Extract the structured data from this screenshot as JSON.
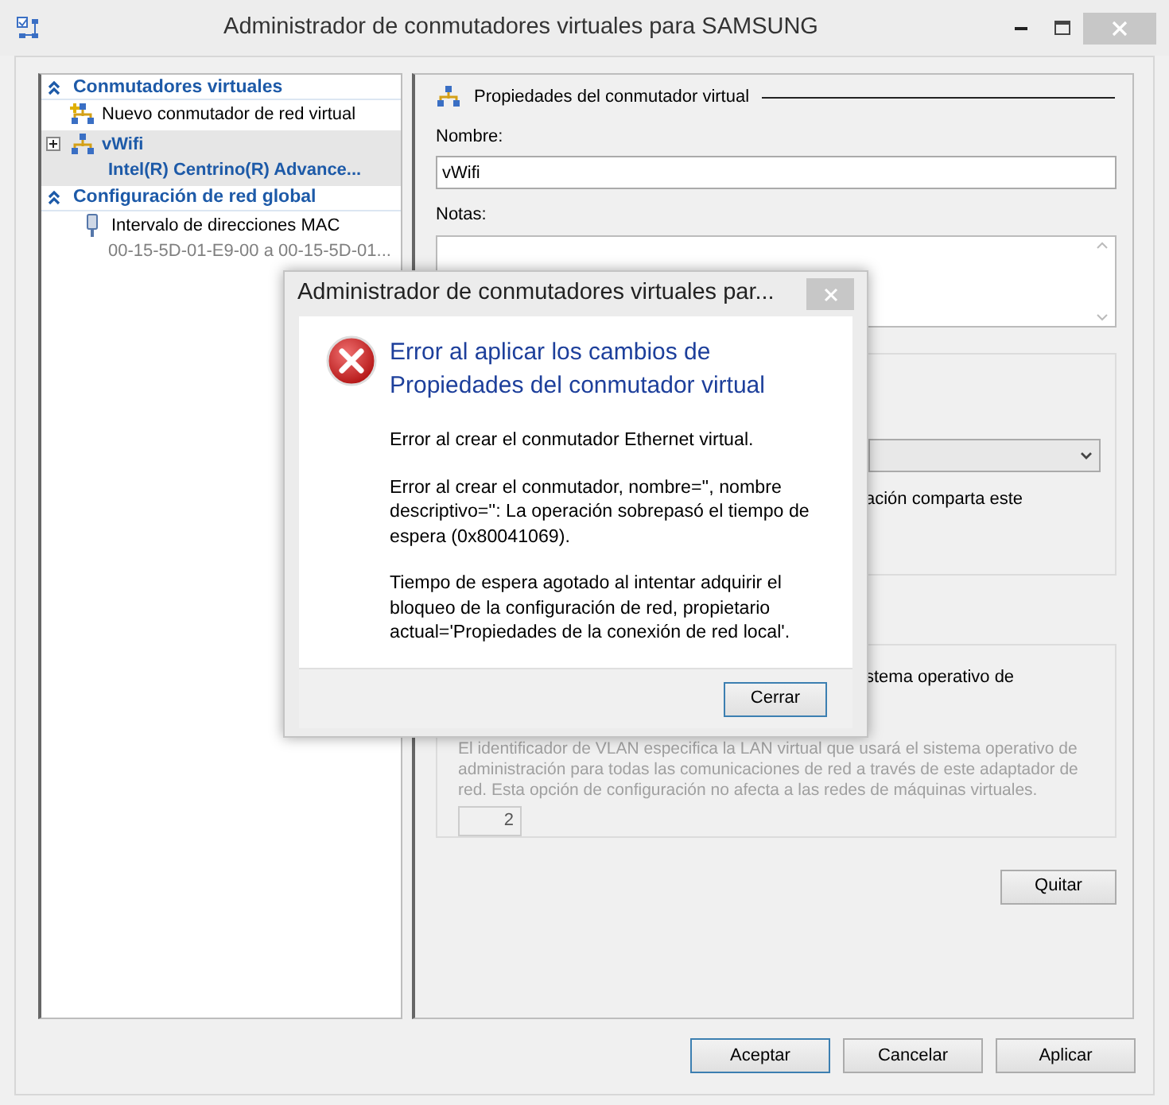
{
  "window": {
    "title": "Administrador de conmutadores virtuales para SAMSUNG"
  },
  "sidebar": {
    "sections": [
      {
        "title": "Conmutadores virtuales",
        "expanded": true,
        "items": [
          {
            "kind": "new",
            "label": "Nuevo conmutador de red virtual",
            "selected": false
          },
          {
            "kind": "switch",
            "label": "vWifi",
            "sublabel": "Intel(R) Centrino(R) Advance...",
            "selected": true,
            "expanded": false
          }
        ]
      },
      {
        "title": "Configuración de red global",
        "expanded": true,
        "items": [
          {
            "kind": "mac",
            "label": "Intervalo de direcciones MAC",
            "sublabel": "00-15-5D-01-E9-00 a 00-15-5D-01...",
            "selected": false
          }
        ]
      }
    ]
  },
  "properties": {
    "title": "Propiedades del conmutador virtual",
    "name_label": "Nombre:",
    "name_value": "vWifi",
    "notes_label": "Notas:",
    "connection_text": "ación comparta este",
    "vlan_text": "stema operativo de",
    "vlan_description": "El identificador de VLAN especifica la LAN virtual que usará el sistema operativo de administración para todas las comunicaciones de red a través de este adaptador de red. Esta opción de configuración no afecta a las redes de máquinas virtuales.",
    "vlan_id": "2",
    "vlan_disabled": true,
    "remove_button": "Quitar"
  },
  "buttons": [
    {
      "label": "Aceptar",
      "default": true
    },
    {
      "label": "Cancelar",
      "default": false
    },
    {
      "label": "Aplicar",
      "default": false
    }
  ],
  "dialog": {
    "title": "Administrador de conmutadores virtuales par...",
    "heading": "Error al aplicar los cambios de Propiedades del conmutador virtual",
    "paragraphs": [
      "Error al crear el conmutador Ethernet virtual.",
      "Error al crear el conmutador, nombre='', nombre descriptivo='': La operación sobrepasó el tiempo de espera (0x80041069).",
      "Tiempo de espera agotado al intentar adquirir el bloqueo de la configuración de red, propietario actual='Propiedades de la conexión de red local'."
    ],
    "buttons": [
      {
        "label": "Cerrar",
        "default": true
      }
    ]
  }
}
